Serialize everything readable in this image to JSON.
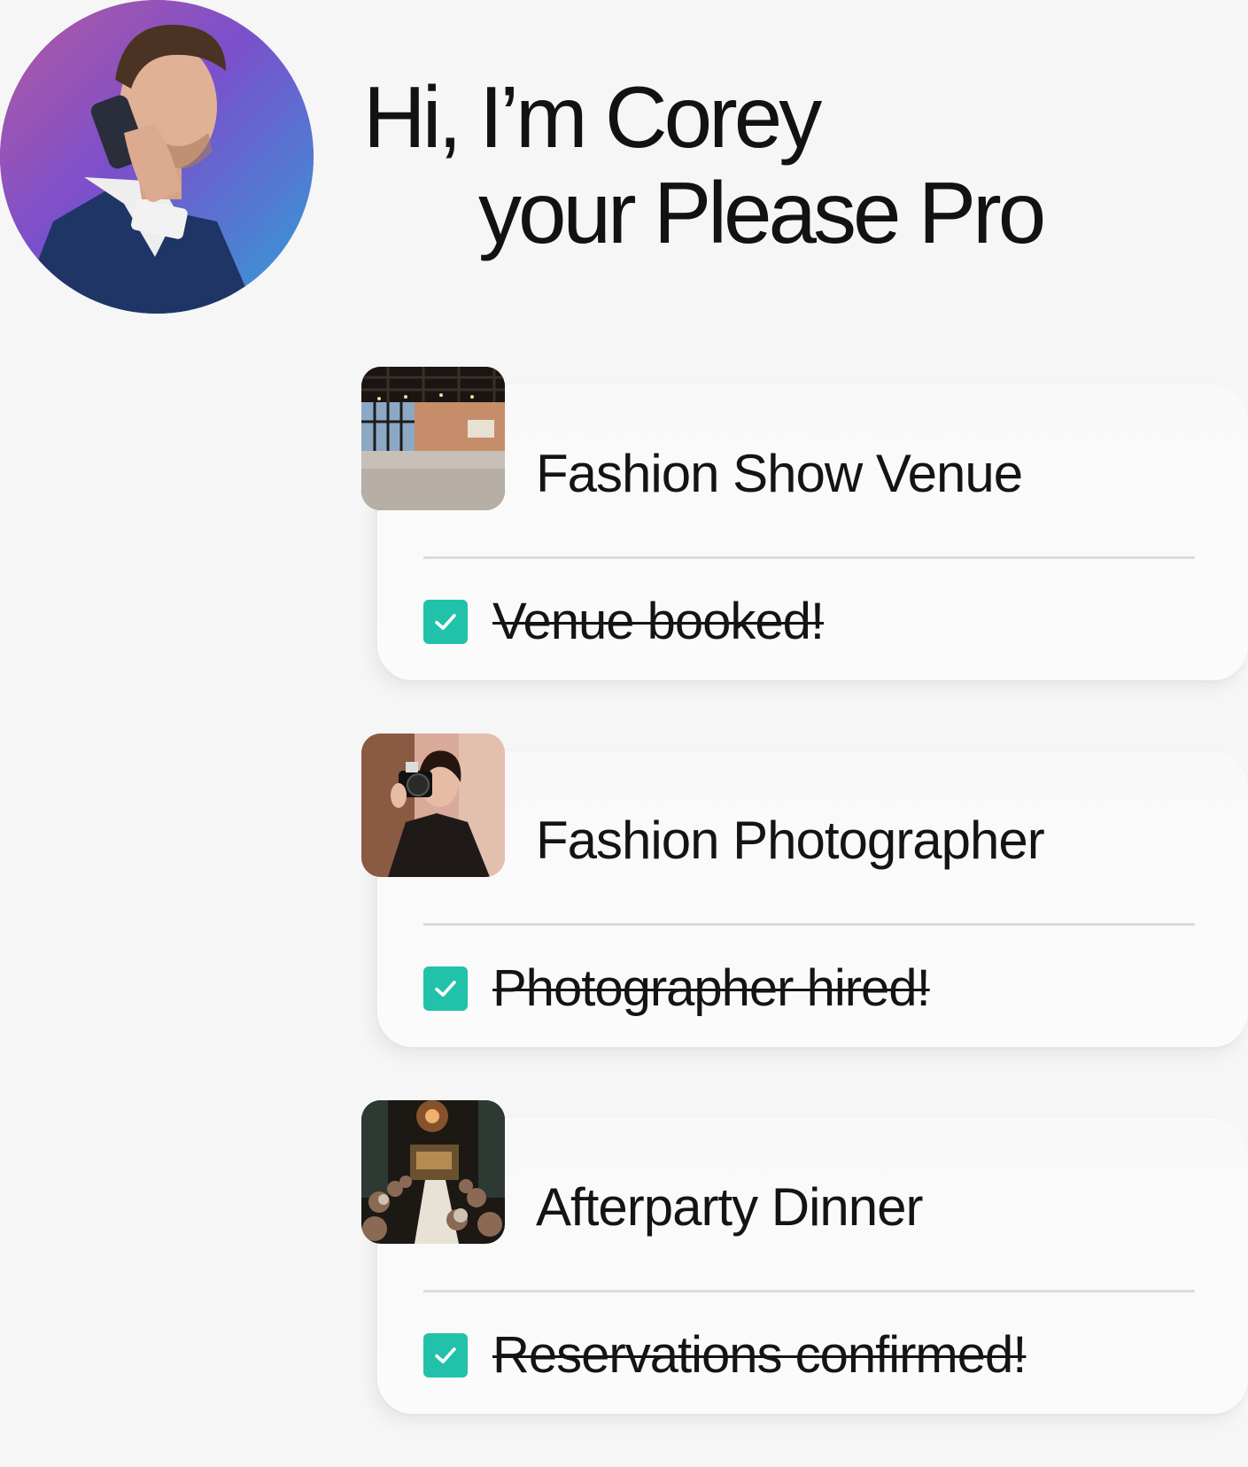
{
  "headline": {
    "line1": "Hi, I’m Corey",
    "line2": "your Please Pro"
  },
  "cards": [
    {
      "title": "Fashion Show Venue",
      "task": "Venue booked!",
      "completed": true,
      "thumbnail": "venue-hall-photo"
    },
    {
      "title": "Fashion Photographer",
      "task": "Photographer hired!",
      "completed": true,
      "thumbnail": "photographer-portrait-photo"
    },
    {
      "title": "Afterparty Dinner",
      "task": "Reservations confirmed!",
      "completed": true,
      "thumbnail": "dinner-party-photo"
    }
  ],
  "colors": {
    "background": "#f6f6f6",
    "checkbox": "#21c2a9",
    "text": "#141414",
    "divider": "#dcdcdc"
  }
}
